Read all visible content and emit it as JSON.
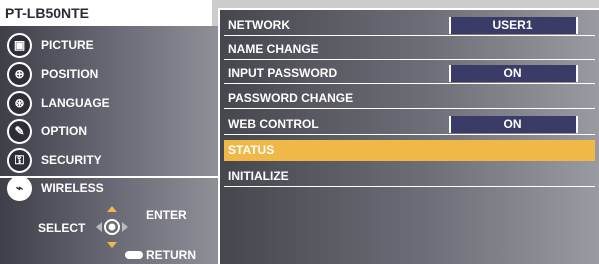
{
  "header": {
    "model": "PT-LB50NTE"
  },
  "menu": [
    {
      "label": "PICTURE",
      "icon": "picture-icon",
      "glyph": "▣"
    },
    {
      "label": "POSITION",
      "icon": "position-icon",
      "glyph": "⊕"
    },
    {
      "label": "LANGUAGE",
      "icon": "language-icon",
      "glyph": "⊛"
    },
    {
      "label": "OPTION",
      "icon": "option-icon",
      "glyph": "✎"
    },
    {
      "label": "SECURITY",
      "icon": "security-icon",
      "glyph": "⚿"
    },
    {
      "label": "WIRELESS",
      "icon": "wireless-icon",
      "glyph": "⌁"
    }
  ],
  "submenu": [
    {
      "label": "NETWORK",
      "value": "USER1"
    },
    {
      "label": "NAME CHANGE",
      "value": ""
    },
    {
      "label": "INPUT PASSWORD",
      "value": "ON"
    },
    {
      "label": "PASSWORD CHANGE",
      "value": ""
    },
    {
      "label": "WEB CONTROL",
      "value": "ON"
    },
    {
      "label": "STATUS",
      "value": ""
    },
    {
      "label": "INITIALIZE",
      "value": ""
    }
  ],
  "help": {
    "select": "SELECT",
    "enter": "ENTER",
    "return": "RETURN"
  },
  "colors": {
    "highlight": "#f0b847",
    "value_box": "#3b3b68"
  }
}
